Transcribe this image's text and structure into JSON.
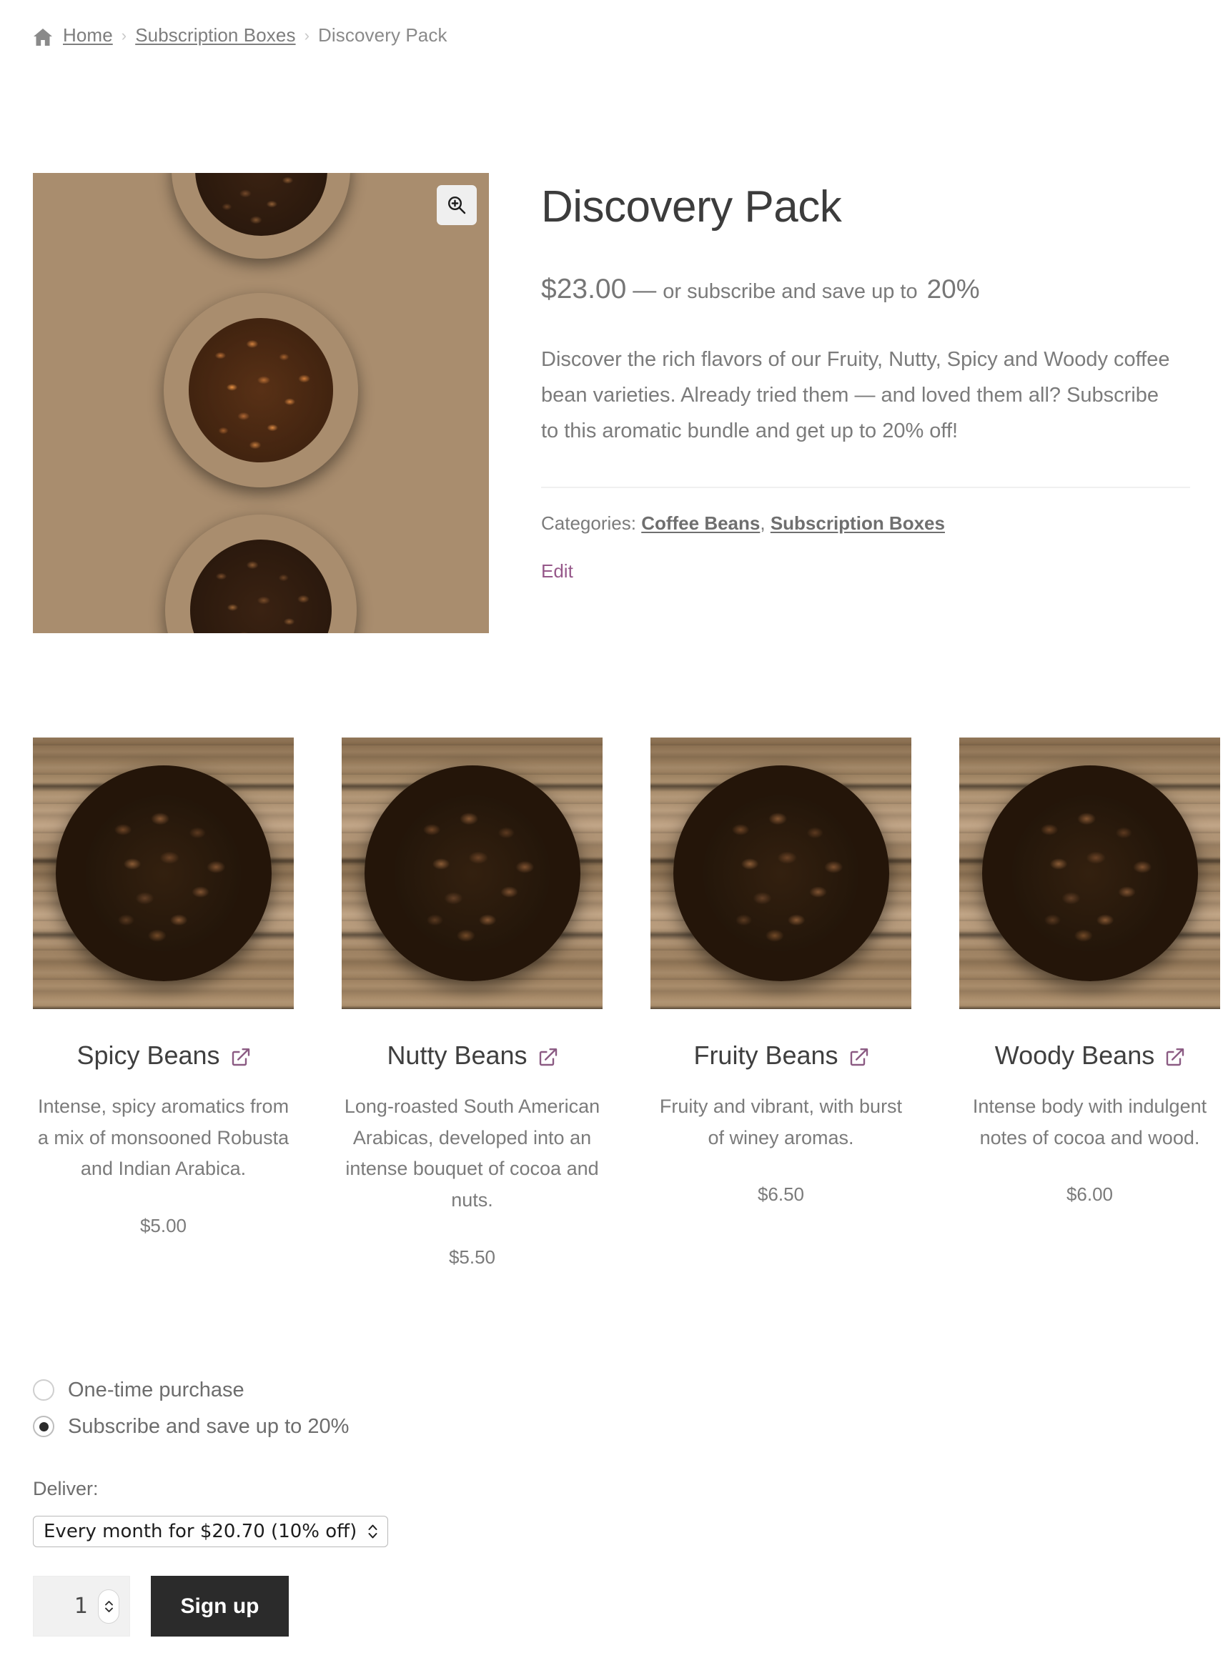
{
  "breadcrumb": {
    "home_icon": "home-icon",
    "items": [
      {
        "label": "Home",
        "link": true
      },
      {
        "label": "Subscription Boxes",
        "link": true
      },
      {
        "label": "Discovery Pack",
        "link": false
      }
    ],
    "separator": "›"
  },
  "gallery": {
    "zoom_icon": "magnifier-plus-icon",
    "image_alt": "Coffee beans in wooden bowls on rustic wood"
  },
  "product": {
    "title": "Discovery Pack",
    "price": "$23.00",
    "price_separator": "—",
    "subscribe_note": "or subscribe and save up to",
    "subscribe_percent": "20%",
    "description": "Discover the rich flavors of our Fruity, Nutty, Spicy and Woody coffee bean varieties. Already tried them — and loved them all? Subscribe to this aromatic bundle and get up to 20% off!",
    "categories_label": "Categories:",
    "categories": [
      "Coffee Beans",
      "Subscription Boxes"
    ],
    "categories_join": ", ",
    "edit_label": "Edit"
  },
  "bundle_items": [
    {
      "name": "Spicy Beans",
      "link_icon": "external-link-icon",
      "description": "Intense, spicy aromatics from a mix of monsooned Robusta and Indian Arabica.",
      "price": "$5.00"
    },
    {
      "name": "Nutty Beans",
      "link_icon": "external-link-icon",
      "description": "Long-roasted South American Arabicas, developed into an intense bouquet of cocoa and nuts.",
      "price": "$5.50"
    },
    {
      "name": "Fruity Beans",
      "link_icon": "external-link-icon",
      "description": "Fruity and vibrant, with burst of winey aromas.",
      "price": "$6.50"
    },
    {
      "name": "Woody Beans",
      "link_icon": "external-link-icon",
      "description": "Intense body with indulgent notes of cocoa and wood.",
      "price": "$6.00"
    }
  ],
  "purchase": {
    "one_time_label": "One-time purchase",
    "subscribe_label": "Subscribe and save up to 20%",
    "selected": "subscribe",
    "deliver_label": "Deliver:",
    "deliver_selected": "Every month for $20.70 (10% off)",
    "quantity": "1",
    "submit_label": "Sign up"
  },
  "colors": {
    "accent_purple": "#96588a",
    "button_dark": "#2b2b2b",
    "text_gray": "#6d6d6d"
  }
}
